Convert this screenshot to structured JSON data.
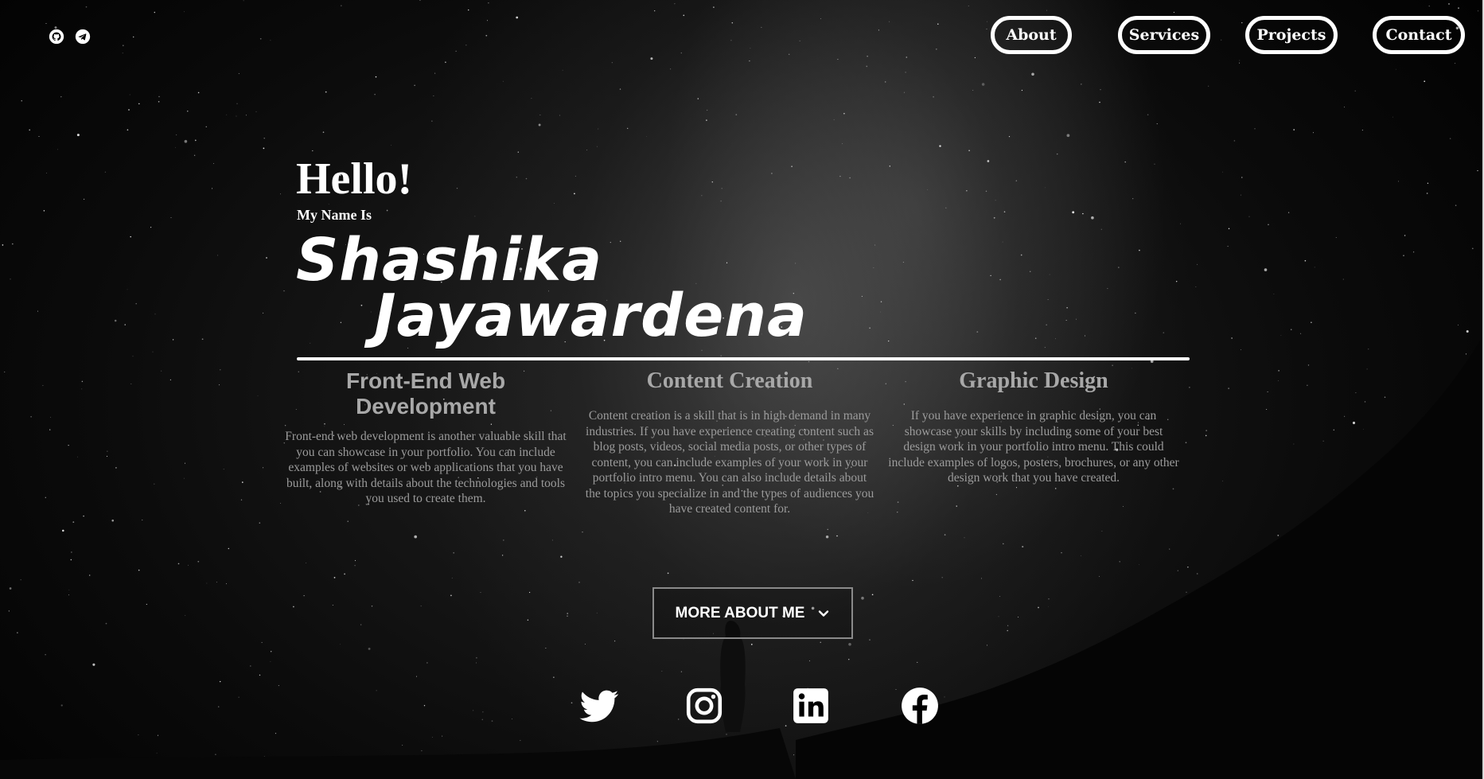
{
  "top_icons": [
    "github-icon",
    "telegram-icon"
  ],
  "nav": {
    "about": "About",
    "services": "Services",
    "projects": "Projects",
    "contact": "Contact"
  },
  "hero": {
    "greeting": "Hello!",
    "intro": "My Name Is",
    "first_name": "Shashika",
    "last_name": "Jayawardena"
  },
  "skills": [
    {
      "title": "Front-End Web Development",
      "description": "Front-end web development is another valuable skill that you can showcase in your portfolio. You can include examples of websites or web applications that you have built, along with details about the technologies and tools you used to create them."
    },
    {
      "title": "Content Creation",
      "description": "Content creation is a skill that is in high demand in many industries. If you have experience creating content such as blog posts, videos, social media posts, or other types of content, you can include examples of your work in your portfolio intro menu. You can also include details about the topics you specialize in and the types of audiences you have created content for."
    },
    {
      "title": "Graphic Design",
      "description": "If you have experience in graphic design, you can showcase your skills by including some of your best design work in your portfolio intro menu. This could include examples of logos, posters, brochures, or any other design work that you have created."
    }
  ],
  "more_button": {
    "label": "MORE ABOUT ME",
    "icon": "chevron-down-icon"
  },
  "social": [
    "twitter-icon",
    "instagram-icon",
    "linkedin-icon",
    "facebook-icon"
  ],
  "colors": {
    "background": "#000000",
    "text": "#ffffff",
    "muted_text": "#9b9b9b"
  }
}
